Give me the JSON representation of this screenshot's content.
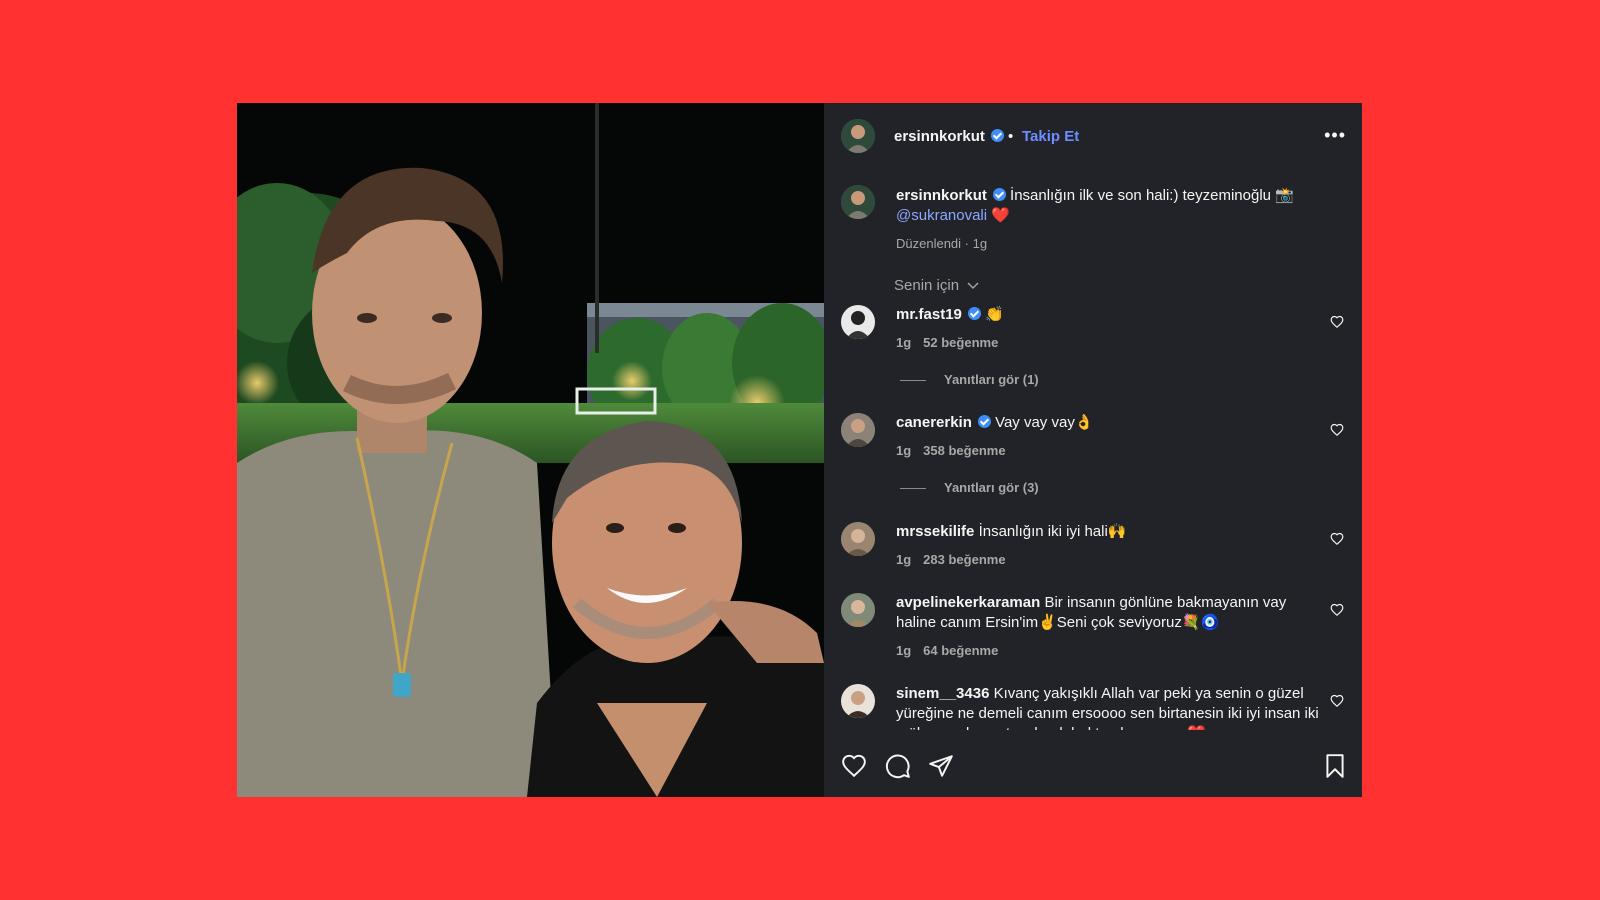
{
  "post": {
    "username": "ersinnkorkut",
    "follow_label": "Takip Et",
    "caption": {
      "username": "ersinnkorkut",
      "text": "İnsanlığın ilk ve son hali:) teyzeminoğlu 📸",
      "mention": "@sukranovali",
      "heart": "❤️"
    },
    "edited_label": "Düzenlendi · 1g",
    "sort_label": "Senin için"
  },
  "comments": [
    {
      "username": "mr.fast19",
      "verified": true,
      "text": "👏",
      "age": "1g",
      "likes": "52 beğenme",
      "replies": "Yanıtları gör (1)"
    },
    {
      "username": "canererkin",
      "verified": true,
      "text": "Vay vay vay👌",
      "age": "1g",
      "likes": "358 beğenme",
      "replies": "Yanıtları gör (3)"
    },
    {
      "username": "mrssekilife",
      "verified": false,
      "text": "İnsanlığın iki iyi hali🙌",
      "age": "1g",
      "likes": "283 beğenme"
    },
    {
      "username": "avpelinekerkaraman",
      "verified": false,
      "text": "Bir insanın gönlüne bakmayanın vay haline canım Ersin'im✌️Seni çok seviyoruz💐🧿",
      "age": "1g",
      "likes": "64 beğenme"
    },
    {
      "username": "sinem__3436",
      "verified": false,
      "text": "Kıvanç yakışıklı Allah var peki ya senin o güzel yüreğine ne demeli canım ersoooo sen birtanesin iki iyi insan iki mükemmel sanatçı olarak baktım bu resme ❤️"
    }
  ],
  "colors": {
    "background": "#ff3131",
    "panel": "#212328",
    "accent": "#6c8dff",
    "verified": "#3e8ef7"
  },
  "icons": [
    "more-options-icon",
    "verified-icon",
    "chevron-down-icon",
    "heart-icon",
    "comment-icon",
    "share-icon",
    "bookmark-icon"
  ]
}
